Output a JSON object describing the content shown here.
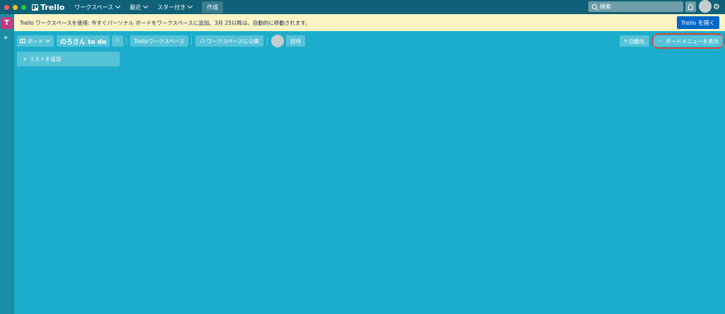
{
  "topbar": {
    "app_name": "Trello",
    "nav": [
      {
        "label": "ワークスペース"
      },
      {
        "label": "最近"
      },
      {
        "label": "スター付き"
      }
    ],
    "create_label": "作成",
    "search_placeholder": "検索"
  },
  "banner": {
    "text": "Trello ワークスペースを使用: 今すぐパーソナル ボードをワークスペースに追加。3月 25以降は、自動的に移動されます。",
    "button_label": "Trello を開く"
  },
  "sidebar": {
    "workspace_initial": "T",
    "expand_glyph": "»"
  },
  "board_header": {
    "switcher_label": "ボード",
    "board_title": "のろさん to do",
    "star_glyph": "☆",
    "workspace_label": "Trelloワークスペース",
    "visibility_label": "ワークスペースに公開",
    "invite_label": "招待",
    "automation_label": "自動化",
    "menu_label": "ボードメニューを表示",
    "menu_glyph": "···"
  },
  "add_list_label": "リストを追加",
  "colors": {
    "board_bg": "#1badcb",
    "topbar_bg": "#0f6177",
    "banner_bg": "#fdf4c6",
    "primary_button": "#0067c8",
    "highlight": "#d44a3f"
  }
}
